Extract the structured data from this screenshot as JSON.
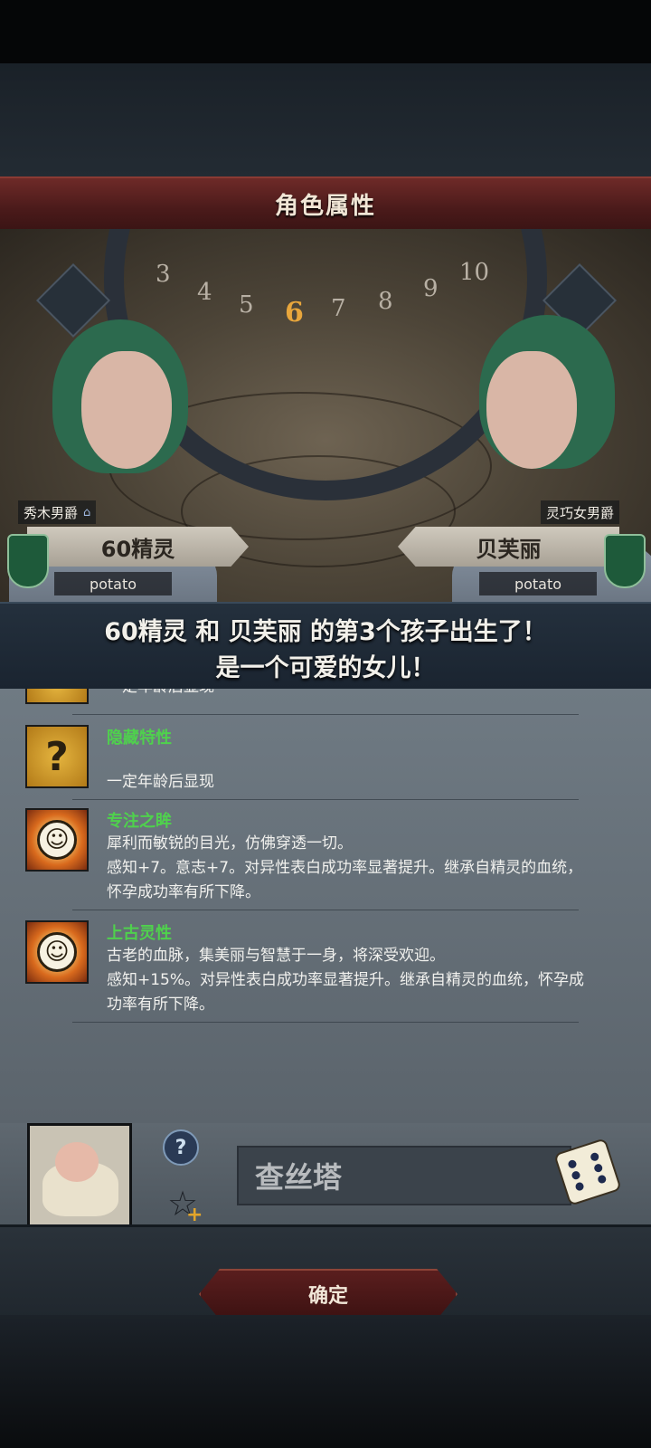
{
  "header": {
    "title": "角色属性"
  },
  "dial": {
    "numbers": [
      "3",
      "4",
      "5",
      "6",
      "7",
      "8",
      "9",
      "10"
    ],
    "current": "6"
  },
  "parents": {
    "father": {
      "title": "秀木男爵",
      "name": "60精灵",
      "player": "potato"
    },
    "mother": {
      "title": "灵巧女男爵",
      "name": "贝芙丽",
      "player": "potato"
    }
  },
  "notice": {
    "line1": "60精灵 和 贝芙丽 的第3个孩子出生了！",
    "line2": "是一个可爱的女儿！"
  },
  "traits": [
    {
      "name": "",
      "desc": "一定年龄后显现",
      "icon": "question-icon"
    },
    {
      "name": "隐藏特性",
      "desc": "一定年龄后显现",
      "icon": "question-icon"
    },
    {
      "name": "专注之眸",
      "desc": "犀利而敏锐的目光，仿佛穿透一切。\n感知+7。意志+7。对异性表白成功率显著提升。继承自精灵的血统，\n怀孕成功率有所下降。",
      "icon": "smile-icon"
    },
    {
      "name": "上古灵性",
      "desc": "古老的血脉，集美丽与智慧于一身，将深受欢迎。\n感知+15%。对异性表白成功率显著提升。继承自精灵的血统，怀孕成\n功率有所下降。",
      "icon": "smile-icon"
    }
  ],
  "child": {
    "name_value": "查丝塔"
  },
  "actions": {
    "confirm_label": "确定"
  },
  "colors": {
    "trait_name": "#4fd14d",
    "banner": "#6e2a28",
    "accent_dial": "#e8a63c"
  }
}
